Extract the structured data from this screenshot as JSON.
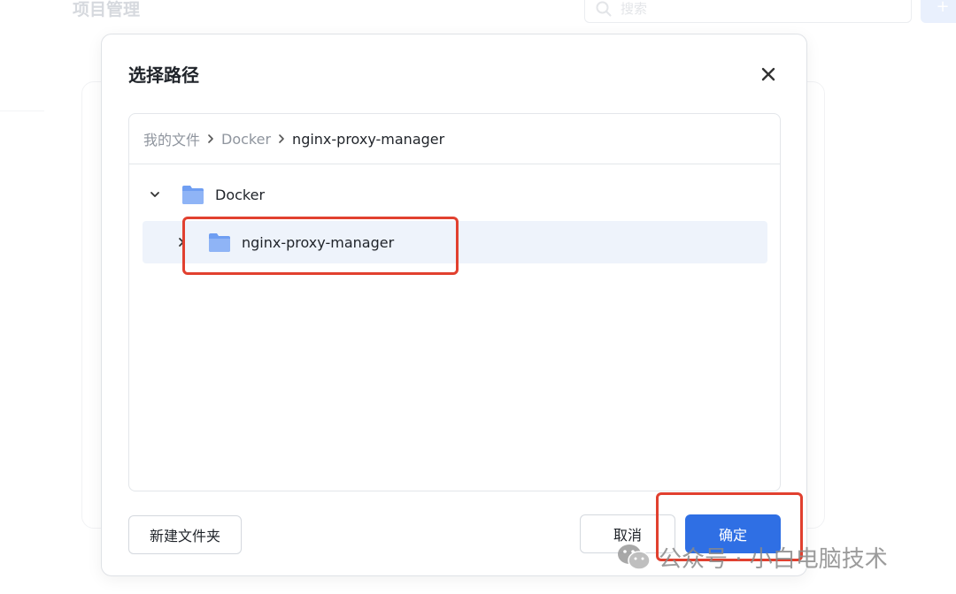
{
  "background": {
    "title": "项目管理",
    "search_placeholder": "搜索",
    "add_label": "+"
  },
  "dialog": {
    "title": "选择路径",
    "breadcrumb": [
      "我的文件",
      "Docker",
      "nginx-proxy-manager"
    ],
    "tree": [
      {
        "label": "Docker",
        "icon": "folder-icon",
        "expanded": true
      },
      {
        "label": "nginx-proxy-manager",
        "icon": "folder-icon",
        "expanded": false,
        "selected": true
      }
    ],
    "new_folder_label": "新建文件夹",
    "cancel_label": "取消",
    "confirm_label": "确定"
  },
  "watermark": {
    "text": "公众号 · 小白电脑技术"
  },
  "colors": {
    "accent": "#2f6fe4",
    "selected_row": "#eef3fb",
    "highlight": "#e1402f",
    "folder": "#7fa8f4"
  }
}
